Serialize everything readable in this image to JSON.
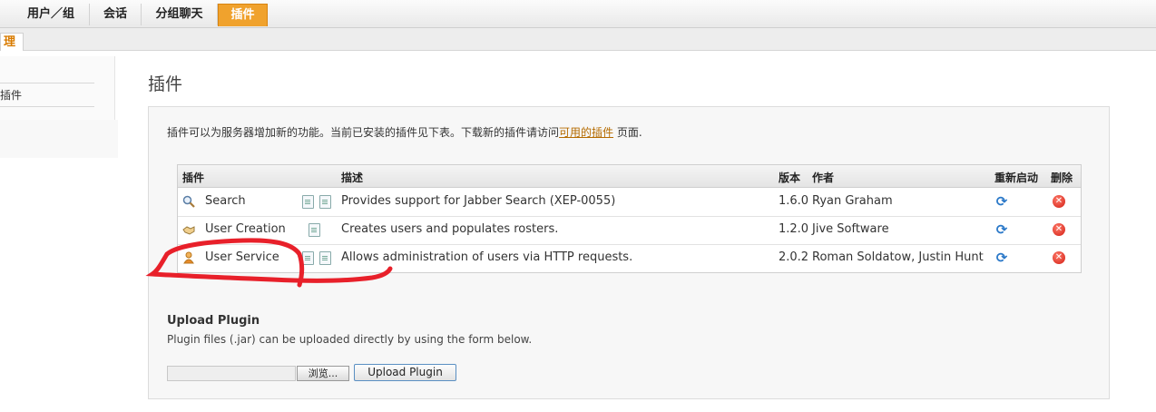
{
  "topnav": {
    "tabs": [
      {
        "label": "用户／组",
        "active": false
      },
      {
        "label": "会话",
        "active": false
      },
      {
        "label": "分组聊天",
        "active": false
      },
      {
        "label": "插件",
        "active": true
      }
    ]
  },
  "subnav": {
    "active_label": "理"
  },
  "sidebar": {
    "items": [
      {
        "label": "插件"
      }
    ]
  },
  "page": {
    "title": "插件"
  },
  "intro": {
    "text_before": "插件可以为服务器增加新的功能。当前已安装的插件见下表。下载新的插件请访问",
    "link": "可用的插件",
    "text_after": " 页面."
  },
  "plugins_table": {
    "headers": {
      "plugin": "插件",
      "description": "描述",
      "version": "版本",
      "author": "作者",
      "restart": "重新启动",
      "delete": "删除"
    },
    "rows": [
      {
        "name": "Search",
        "icon": "magnifier-icon",
        "description": "Provides support for Jabber Search (XEP-0055)",
        "version": "1.6.0",
        "author": "Ryan Graham"
      },
      {
        "name": "User Creation",
        "icon": "handshake-icon",
        "description": "Creates users and populates rosters.",
        "version": "1.2.0",
        "author": "Jive Software"
      },
      {
        "name": "User Service",
        "icon": "user-icon",
        "description": "Allows administration of users via HTTP requests.",
        "version": "2.0.2",
        "author": "Roman Soldatow, Justin Hunt"
      }
    ]
  },
  "upload": {
    "title": "Upload Plugin",
    "description": "Plugin files (.jar) can be uploaded directly by using the form below.",
    "browse_label": "浏览...",
    "button_label": "Upload Plugin"
  },
  "colors": {
    "accent": "#f0a22d",
    "link": "#b56b00",
    "annotation": "#e8202a"
  }
}
